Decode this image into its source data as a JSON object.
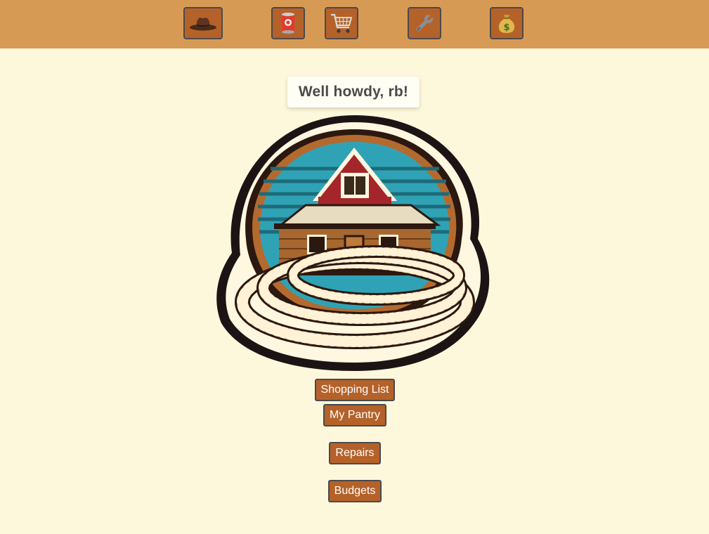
{
  "header": {
    "nav": [
      {
        "name": "home",
        "icon": "cowboy-hat-icon"
      },
      {
        "name": "pantry",
        "icon": "tin-can-icon"
      },
      {
        "name": "shopping",
        "icon": "shopping-cart-icon"
      },
      {
        "name": "repairs",
        "icon": "wrench-icon"
      },
      {
        "name": "budgets",
        "icon": "money-bag-icon"
      }
    ]
  },
  "main": {
    "greeting": "Well howdy, rb!",
    "logo": {
      "icon": "ranch-house-lasso-logo"
    },
    "buttons": {
      "shopping_list": "Shopping List",
      "my_pantry": "My Pantry",
      "repairs": "Repairs",
      "budgets": "Budgets"
    }
  },
  "colors": {
    "topbar": "#d79a55",
    "background": "#fdf8dc",
    "button": "#b4622a",
    "button_border": "#4a4a4a",
    "greeting_text": "#4a4a4a"
  }
}
